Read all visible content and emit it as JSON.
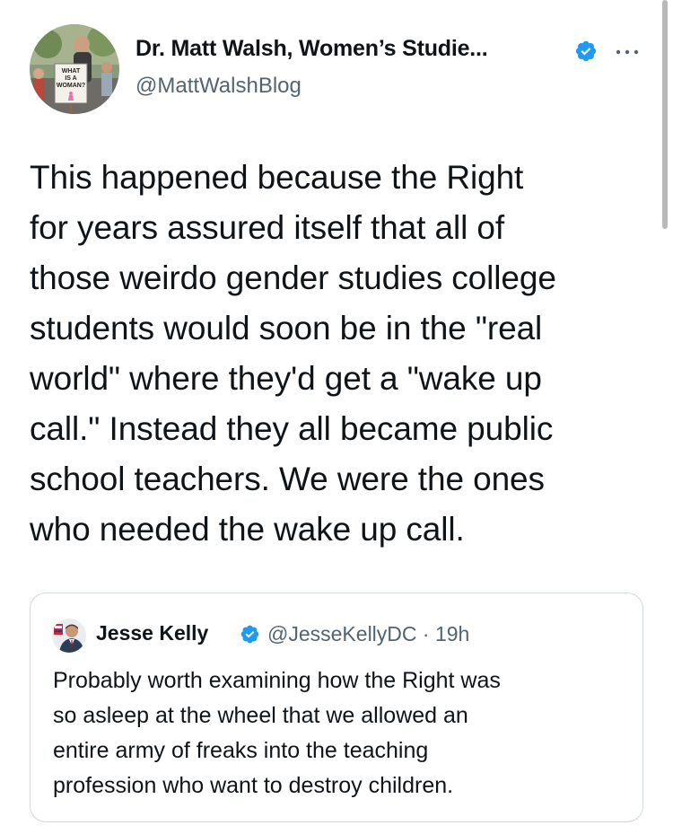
{
  "tweet": {
    "author_name": "Dr. Matt Walsh, Women’s Studie...",
    "handle": "@MattWalshBlog",
    "text_lines": [
      "This happened because the Right",
      "for years assured itself that all of",
      "those weirdo gender studies college",
      "students would soon be in the \"real",
      "world\" where they'd get a \"wake up",
      "call.\" Instead they all became public",
      "school teachers. We were the ones",
      "who needed the wake up call."
    ],
    "avatar_sign": [
      "WHAT",
      "IS A",
      "WOMAN?"
    ]
  },
  "quote": {
    "author_name": "Jesse Kelly",
    "handle_time": "@JesseKellyDC · 19h",
    "text_lines": [
      "Probably worth examining how the Right was",
      "so asleep at the wheel that we allowed an",
      "entire army of freaks into the teaching",
      "profession who want to destroy children."
    ]
  },
  "icons": {
    "verified": "verified-badge-icon",
    "more": "more-options-icon"
  },
  "colors": {
    "verified_blue": "#1d9bf0",
    "text": "#0f1419",
    "secondary_text": "#536471",
    "border": "#cfd9de"
  }
}
